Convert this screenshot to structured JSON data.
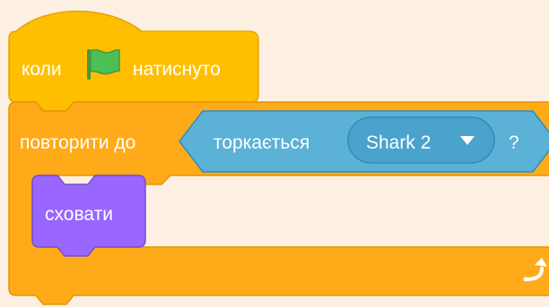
{
  "colors": {
    "background": "#fdf0e3",
    "events": "#ffbf00",
    "events_border": "#e6a400",
    "control": "#ffab19",
    "control_border": "#e59400",
    "sensing": "#5cb1d6",
    "sensing_border": "#2e8eb8",
    "looks": "#9966ff",
    "looks_border": "#774dcb",
    "flag_green": "#4cbf56",
    "flag_green_dark": "#45993d"
  },
  "hat_block": {
    "prefix": "коли",
    "suffix": "натиснуто",
    "icon": "green-flag-icon"
  },
  "repeat_block": {
    "label": "повторити до",
    "loop_icon": "repeat-arrow-icon"
  },
  "condition_block": {
    "label": "торкається",
    "dropdown_value": "Shark 2",
    "dropdown_icon": "dropdown-arrow-icon",
    "suffix": "?"
  },
  "hide_block": {
    "label": "сховати"
  }
}
